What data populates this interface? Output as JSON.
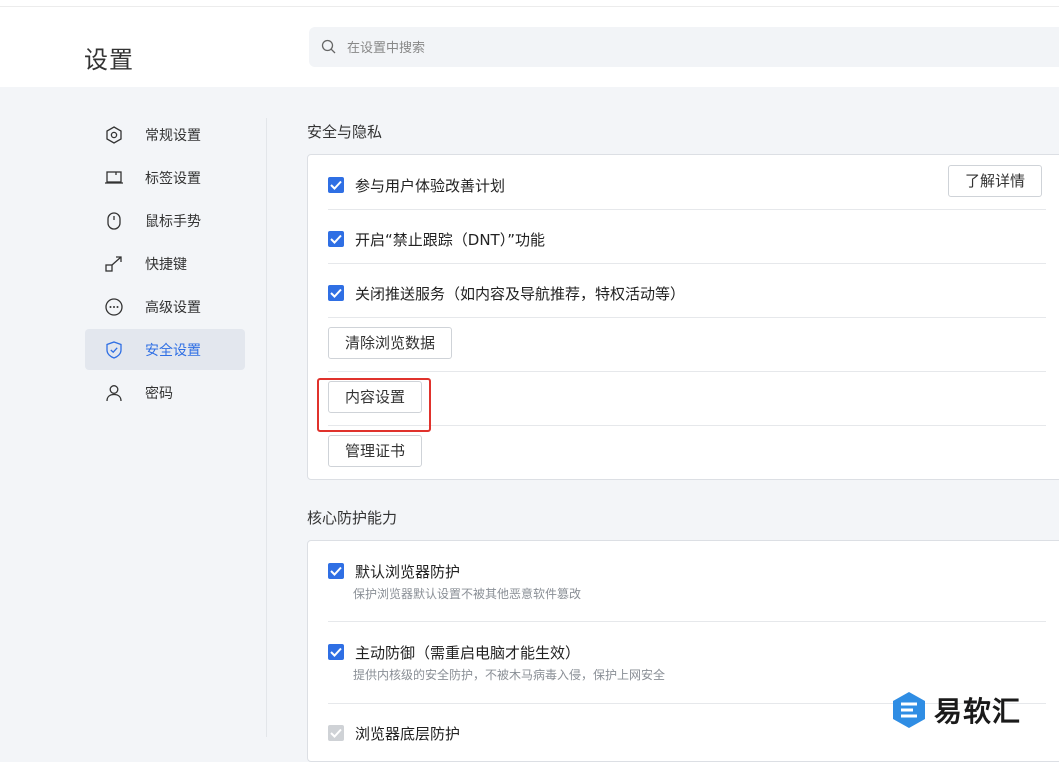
{
  "header": {
    "title": "设置",
    "search": {
      "placeholder": "在设置中搜索",
      "value": ""
    }
  },
  "sidebar": {
    "items": [
      {
        "label": "常规设置",
        "icon": "hexagon-gear-icon"
      },
      {
        "label": "标签设置",
        "icon": "laptop-icon"
      },
      {
        "label": "鼠标手势",
        "icon": "mouse-icon"
      },
      {
        "label": "快捷键",
        "icon": "arrow-out-icon"
      },
      {
        "label": "高级设置",
        "icon": "more-circle-icon"
      },
      {
        "label": "安全设置",
        "icon": "shield-check-icon",
        "active": true
      },
      {
        "label": "密码",
        "icon": "user-icon"
      }
    ]
  },
  "security": {
    "title": "安全与隐私",
    "rows": {
      "ux_plan": {
        "label": "参与用户体验改善计划",
        "checked": true,
        "button": "了解详情"
      },
      "dnt": {
        "label": "开启“禁止跟踪（DNT）”功能",
        "checked": true
      },
      "push": {
        "label": "关闭推送服务（如内容及导航推荐，特权活动等）",
        "checked": true
      }
    },
    "buttons": {
      "clear_data": "清除浏览数据",
      "content_settings": "内容设置",
      "manage_certs": "管理证书"
    }
  },
  "core": {
    "title": "核心防护能力",
    "rows": {
      "default_browser": {
        "label": "默认浏览器防护",
        "desc": "保护浏览器默认设置不被其他恶意软件篡改",
        "checked": true
      },
      "active_defense": {
        "label": "主动防御（需重启电脑才能生效）",
        "desc": "提供内核级的安全防护，不被木马病毒入侵，保护上网安全",
        "checked": true
      },
      "low_level": {
        "label": "浏览器底层防护",
        "checked": true,
        "disabled": true
      }
    }
  },
  "watermark": {
    "text": "易软汇"
  },
  "colors": {
    "accent": "#2f6fe4",
    "highlight": "#e0322c"
  }
}
